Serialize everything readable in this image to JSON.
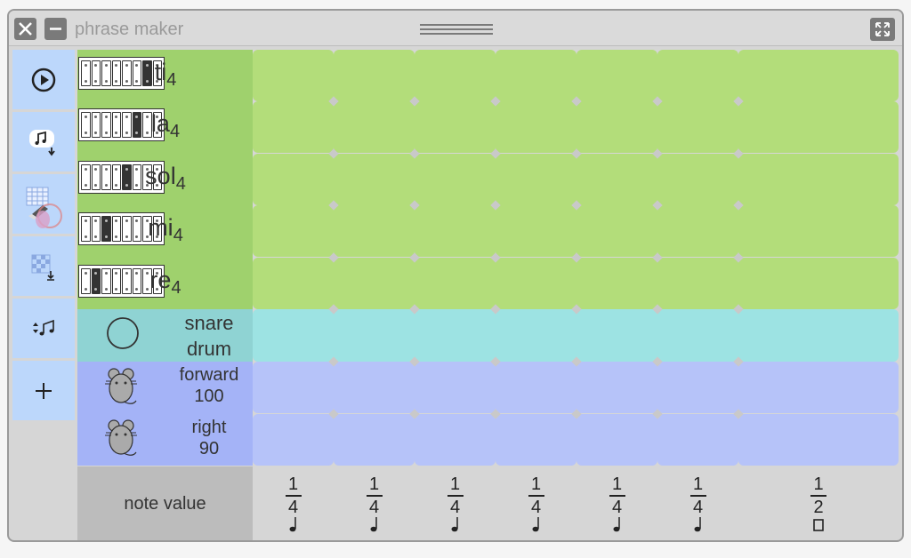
{
  "window": {
    "title": "phrase maker"
  },
  "sidebar": {
    "buttons": [
      {
        "name": "play-button",
        "icon": "play-icon"
      },
      {
        "name": "save-button",
        "icon": "save-notes-icon"
      },
      {
        "name": "erase-button",
        "icon": "eraser-grid-icon"
      },
      {
        "name": "export-button",
        "icon": "grid-download-icon"
      },
      {
        "name": "sort-button",
        "icon": "sort-notes-icon"
      },
      {
        "name": "add-row-button",
        "icon": "plus-icon"
      }
    ]
  },
  "pitch_rows": [
    {
      "name": "ti",
      "octave": "4",
      "bar": 7
    },
    {
      "name": "la",
      "octave": "4",
      "bar": 6
    },
    {
      "name": "sol",
      "octave": "4",
      "bar": 5
    },
    {
      "name": "mi",
      "octave": "4",
      "bar": 3
    },
    {
      "name": "re",
      "octave": "4",
      "bar": 2
    }
  ],
  "drum_rows": [
    {
      "line1": "snare",
      "line2": "drum",
      "icon": "snare-drum-icon"
    }
  ],
  "mouse_rows": [
    {
      "line1": "forward",
      "line2": "100",
      "icon": "mouse-icon"
    },
    {
      "line1": "right",
      "line2": "90",
      "icon": "mouse-icon"
    }
  ],
  "note_value_label": "note value",
  "note_values": [
    {
      "num": "1",
      "den": "4"
    },
    {
      "num": "1",
      "den": "4"
    },
    {
      "num": "1",
      "den": "4"
    },
    {
      "num": "1",
      "den": "4"
    },
    {
      "num": "1",
      "den": "4"
    },
    {
      "num": "1",
      "den": "4"
    },
    {
      "num": "1",
      "den": "2"
    }
  ],
  "colors": {
    "pitch": "#b3dd7a",
    "pitch_label": "#9fd16d",
    "drum": "#9de3e3",
    "drum_label": "#8fd3d3",
    "mouse": "#b6c3f9",
    "mouse_label": "#a4b3f7",
    "sidebar": "#bcd7fb"
  }
}
